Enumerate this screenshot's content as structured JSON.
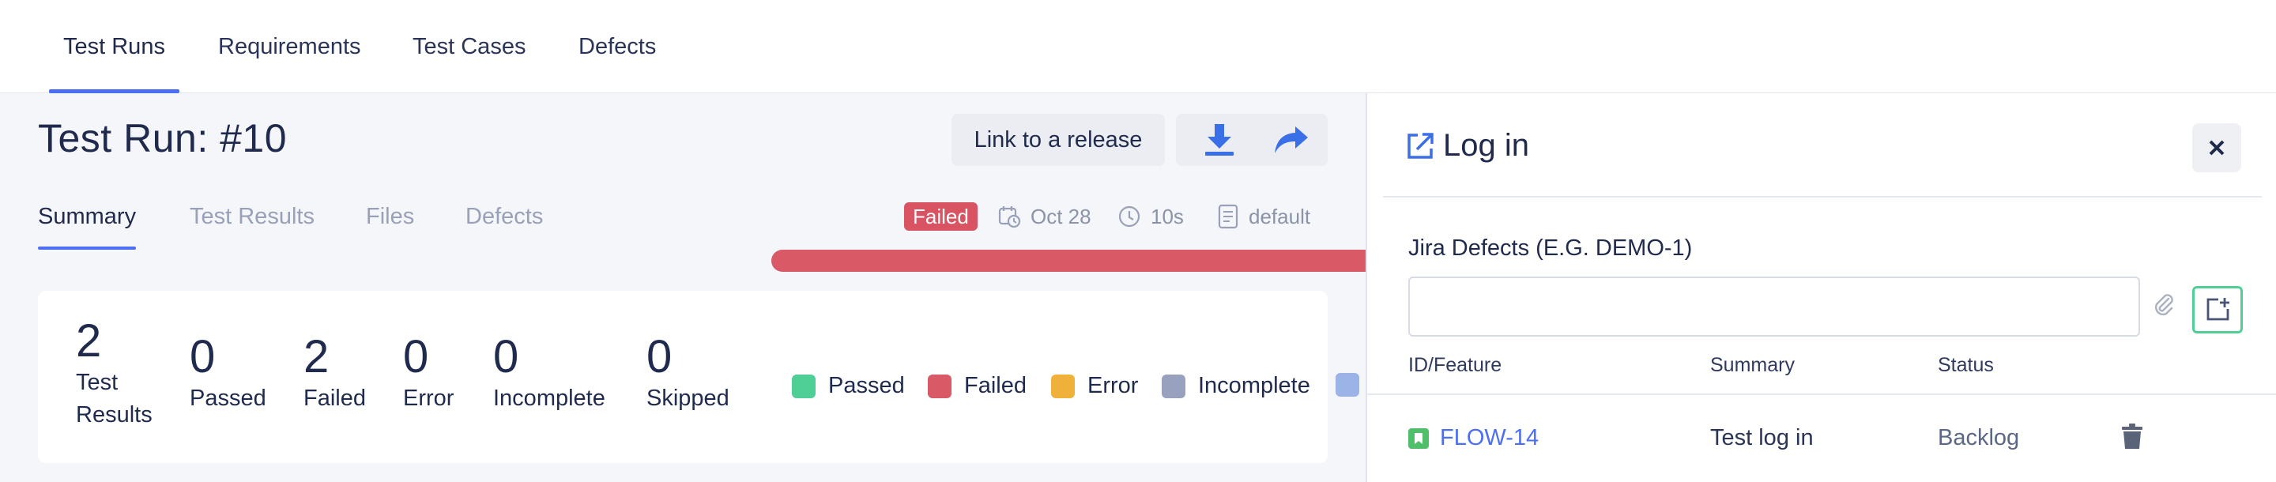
{
  "nav": {
    "tabs": [
      {
        "label": "Test Runs",
        "active": true
      },
      {
        "label": "Requirements",
        "active": false
      },
      {
        "label": "Test Cases",
        "active": false
      },
      {
        "label": "Defects",
        "active": false
      }
    ]
  },
  "run": {
    "title": "Test Run: #10",
    "link_release_label": "Link to a release",
    "download_icon": "download-icon",
    "share_icon": "share-icon",
    "subtabs": [
      "Summary",
      "Test Results",
      "Files",
      "Defects"
    ],
    "status_badge": "Failed",
    "date": "Oct 28",
    "duration": "10s",
    "environment": "default"
  },
  "summary": {
    "total": {
      "value": "2",
      "label_line1": "Test",
      "label_line2": "Results"
    },
    "passed": {
      "value": "0",
      "label": "Passed"
    },
    "failed": {
      "value": "2",
      "label": "Failed"
    },
    "error": {
      "value": "0",
      "label": "Error"
    },
    "incomplete": {
      "value": "0",
      "label": "Incomplete"
    },
    "skipped": {
      "value": "0",
      "label": "Skipped"
    }
  },
  "legend": [
    {
      "label": "Passed",
      "color": "#4fcf96"
    },
    {
      "label": "Failed",
      "color": "#d95967"
    },
    {
      "label": "Error",
      "color": "#f0b13a"
    },
    {
      "label": "Incomplete",
      "color": "#98a1bd"
    },
    {
      "label": "",
      "color": "#9bb3e6"
    }
  ],
  "colors": {
    "accent": "#4c6ef5",
    "failed": "#d95462",
    "add_border": "#4fcf96"
  },
  "panel": {
    "title": "Log in",
    "title_icon": "external-link-icon",
    "close_icon": "close-icon",
    "field_label": "Jira Defects (E.G. DEMO-1)",
    "field_value": "",
    "field_placeholder": "",
    "columns": [
      "ID/Feature",
      "Summary",
      "Status"
    ],
    "rows": [
      {
        "id": "FLOW-14",
        "summary": "Test log in",
        "status": "Backlog"
      }
    ]
  }
}
